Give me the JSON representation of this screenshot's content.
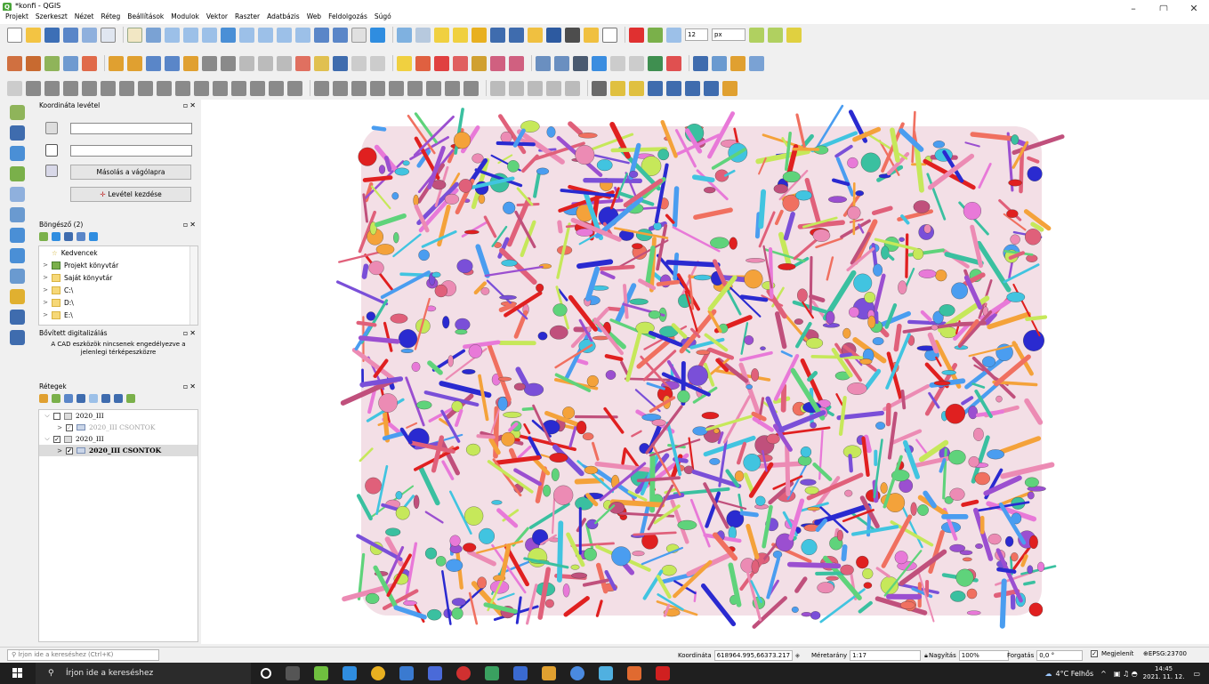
{
  "window": {
    "title": "*konfi - QGIS",
    "controls": [
      "–",
      "▢",
      "✕"
    ]
  },
  "menu": [
    "Projekt",
    "Szerkeszt",
    "Nézet",
    "Réteg",
    "Beállítások",
    "Modulok",
    "Vektor",
    "Raszter",
    "Adatbázis",
    "Web",
    "Feldolgozás",
    "Súgó"
  ],
  "toolbar": {
    "size_value": "12",
    "unit_value": "px"
  },
  "coord_panel": {
    "title": "Koordináta levétel",
    "copy_button": "Másolás a vágólapra",
    "start_button": "Levétel kezdése"
  },
  "browser_panel": {
    "title": "Böngésző (2)",
    "items": [
      "Kedvencek",
      "Projekt könyvtár",
      "Saját könyvtár",
      "C:\\",
      "D:\\",
      "E:\\"
    ]
  },
  "adv_panel": {
    "title": "Bővített digitalizálás",
    "message": "A CAD eszközök nincsenek engedélyezve a jelenlegi térképeszközre"
  },
  "layers_panel": {
    "title": "Rétegek",
    "items": [
      {
        "label": "2020_III",
        "level": 0,
        "checked": false
      },
      {
        "label": "2020_III CSONTOK",
        "level": 1,
        "checked": true
      },
      {
        "label": "2020_III",
        "level": 0,
        "checked": true
      },
      {
        "label": "2020_III CSONTOK",
        "level": 1,
        "checked": true
      }
    ]
  },
  "status": {
    "locator_placeholder": "Írjon ide a kereséshez (Ctrl+K)",
    "coord_label": "Koordináta",
    "coord_value": "618964.995,66373.217",
    "scale_label": "Méretarány",
    "scale_value": "1:17",
    "zoom_label": "Nagyítás",
    "zoom_value": "100%",
    "rotation_label": "Forgatás",
    "rotation_value": "0,0 °",
    "render_label": "Megjelenít",
    "crs": "EPSG:23700"
  },
  "taskbar": {
    "search_placeholder": "Írjon ide a kereséshez",
    "weather": "4°C Felhős",
    "time": "14:45",
    "date": "2021. 11. 12."
  },
  "colors": {
    "palette": [
      "#e0607a",
      "#c0507c",
      "#9b4fd0",
      "#e879d8",
      "#5fd37b",
      "#41c4e0",
      "#f4a23a",
      "#2a2ad0",
      "#e02020",
      "#c6e85a",
      "#ec8bb4",
      "#7a4fd8",
      "#4a9df0",
      "#f07060",
      "#3ac0a0"
    ]
  }
}
